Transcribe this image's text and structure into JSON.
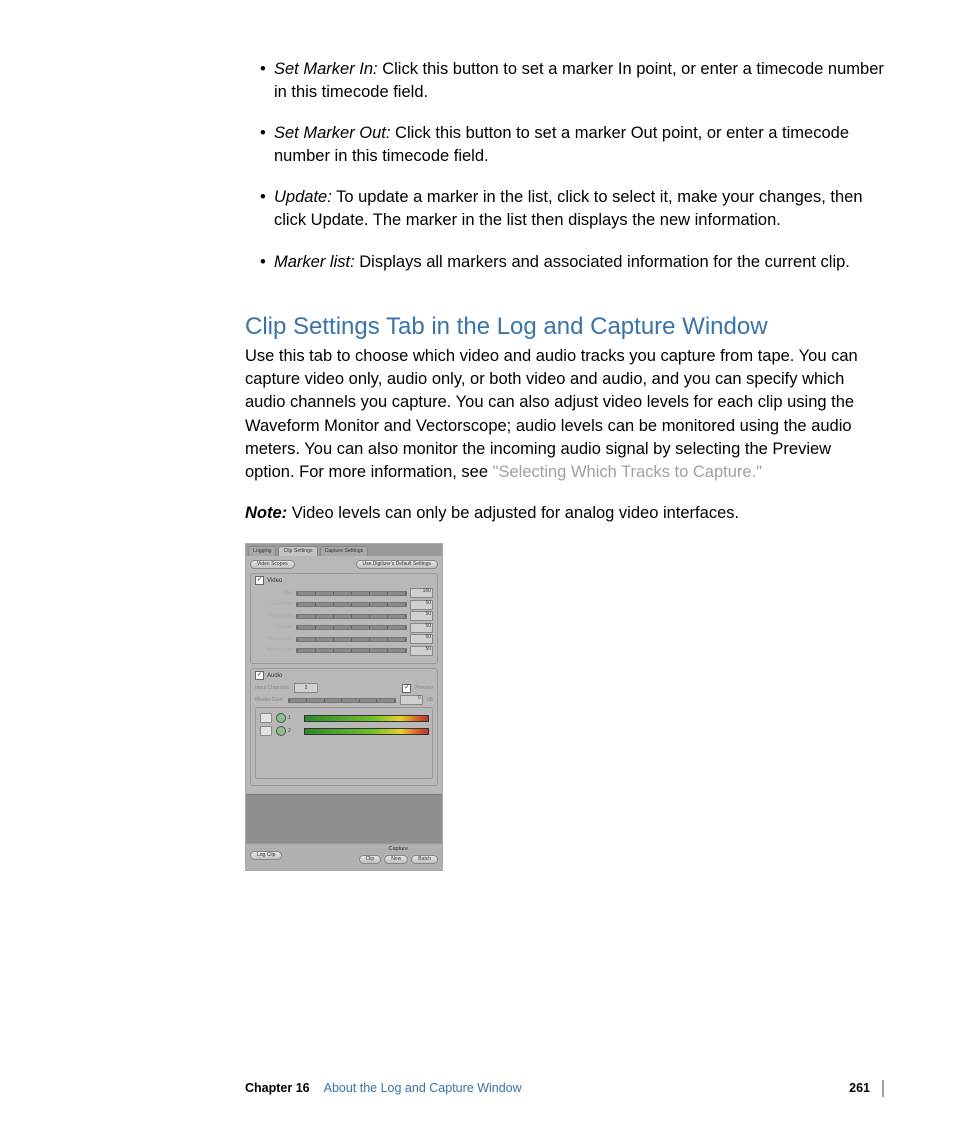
{
  "bullets": [
    {
      "term": "Set Marker In:",
      "body": "  Click this button to set a marker In point, or enter a timecode number in this timecode field."
    },
    {
      "term": "Set Marker Out:",
      "body": "  Click this button to set a marker Out point, or enter a timecode number in this timecode field."
    },
    {
      "term": "Update:",
      "body": "  To update a marker in the list, click to select it, make your changes, then click Update. The marker in the list then displays the new information."
    },
    {
      "term": "Marker list:",
      "body": "  Displays all markers and associated information for the current clip."
    }
  ],
  "heading": "Clip Settings Tab in the Log and Capture Window",
  "intro_1": "Use this tab to choose which video and audio tracks you capture from tape. You can capture video only, audio only, or both video and audio, and you can specify which audio channels you capture. You can also adjust video levels for each clip using the Waveform Monitor and Vectorscope; audio levels can be monitored using the audio meters. You can also monitor the incoming audio signal by selecting the Preview option. For more information, see ",
  "intro_link": "\"Selecting Which Tracks to Capture.\"",
  "note_label": "Note:",
  "note_body": "  Video levels can only be adjusted for analog video interfaces.",
  "shot": {
    "tabs": [
      "Logging",
      "Clip Settings",
      "Capture Settings"
    ],
    "video_scopes": "Video Scopes",
    "defaults_btn": "Use Digitizer's Default Settings",
    "video_label": "Video",
    "sliders": [
      {
        "label": "Hue",
        "val": "180"
      },
      {
        "label": "Saturation",
        "val": "50"
      },
      {
        "label": "Brightness",
        "val": "50"
      },
      {
        "label": "Contrast",
        "val": "50"
      },
      {
        "label": "Black Level",
        "val": "50"
      },
      {
        "label": "White Level",
        "val": "50"
      }
    ],
    "audio_label": "Audio",
    "input_channels_label": "Input Channels:",
    "input_channels_val": "2",
    "preview_label": "Preview",
    "master_gain_label": "Master Gain:",
    "master_gain_val": "0",
    "db_suffix": "dB",
    "meter_nums": [
      "1",
      "2"
    ],
    "log_clip": "Log Clip",
    "capture_label": "Capture",
    "capture_buttons": [
      "Clip",
      "Now",
      "Batch"
    ]
  },
  "footer": {
    "chapter": "Chapter 16",
    "title": "About the Log and Capture Window",
    "page": "261"
  }
}
